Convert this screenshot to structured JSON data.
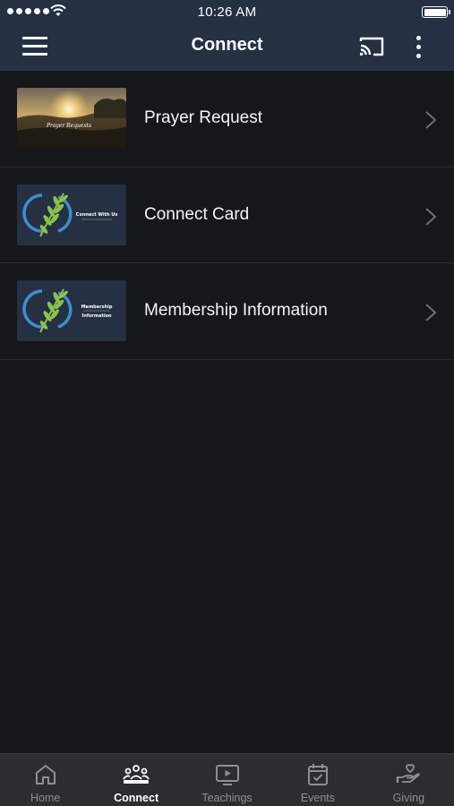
{
  "status_bar": {
    "time": "10:26 AM"
  },
  "header": {
    "title": "Connect",
    "menu_icon": "hamburger-menu-icon",
    "cast_icon": "cast-icon",
    "more_icon": "more-vertical-icon"
  },
  "items": [
    {
      "label": "Prayer Request",
      "thumb_text": "Prayer Requests"
    },
    {
      "label": "Connect Card",
      "thumb_text": "Connect With Us"
    },
    {
      "label": "Membership Information",
      "thumb_text_1": "Membership",
      "thumb_text_2": "Information"
    }
  ],
  "tabs": [
    {
      "label": "Home",
      "icon": "home-icon",
      "active": false
    },
    {
      "label": "Connect",
      "icon": "people-icon",
      "active": true
    },
    {
      "label": "Teachings",
      "icon": "tv-play-icon",
      "active": false
    },
    {
      "label": "Events",
      "icon": "calendar-icon",
      "active": false
    },
    {
      "label": "Giving",
      "icon": "heart-hand-icon",
      "active": false
    }
  ],
  "colors": {
    "header_bg": "#253043",
    "page_bg": "#16171a",
    "tabbar_bg": "#2c2d30",
    "thumb_bg": "#253043",
    "leaf_green": "#8bc34a",
    "ring_blue": "#3e8ed0"
  }
}
